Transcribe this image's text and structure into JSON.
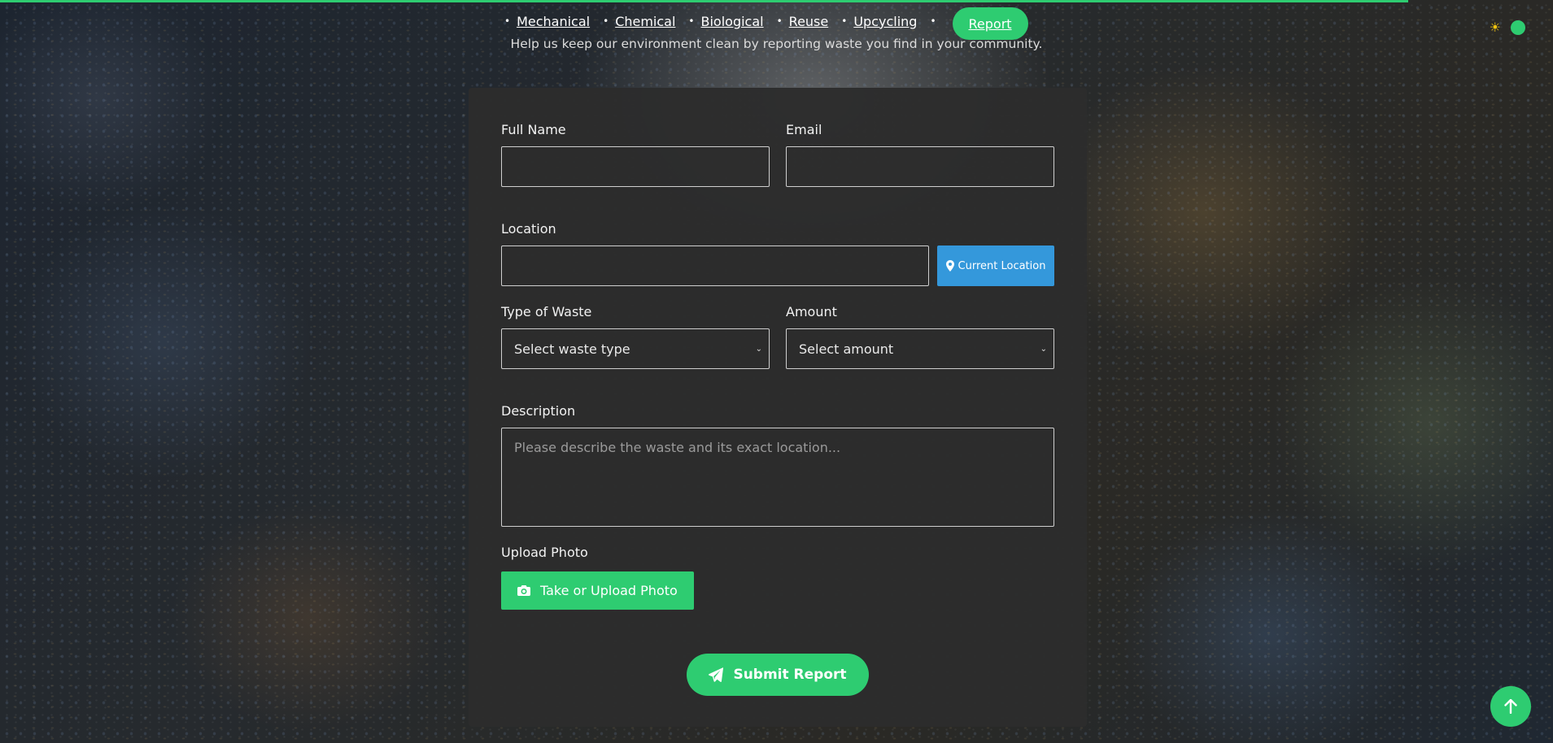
{
  "nav": {
    "items": [
      {
        "label": "Mechanical"
      },
      {
        "label": "Chemical"
      },
      {
        "label": "Biological"
      },
      {
        "label": "Reuse"
      },
      {
        "label": "Upcycling"
      }
    ],
    "report_label": "Report"
  },
  "header": {
    "subtitle": "Help us keep our environment clean by reporting waste you find in your community."
  },
  "form": {
    "full_name_label": "Full Name",
    "full_name_value": "",
    "email_label": "Email",
    "email_value": "",
    "location_label": "Location",
    "location_value": "",
    "current_location_label": "Current Location",
    "waste_type_label": "Type of Waste",
    "waste_type_selected": "Select waste type",
    "amount_label": "Amount",
    "amount_selected": "Select amount",
    "description_label": "Description",
    "description_placeholder": "Please describe the waste and its exact location...",
    "upload_label": "Upload Photo",
    "upload_button_label": "Take or Upload Photo",
    "submit_label": "Submit Report"
  },
  "icons": {
    "theme": "sun-icon",
    "location": "map-pin-icon",
    "camera": "camera-icon",
    "send": "paper-plane-icon",
    "scroll_top": "arrow-up-icon"
  },
  "colors": {
    "accent": "#2ecc71",
    "location_button": "#3498db",
    "card_background": "#2c2c2c",
    "sun": "#f1c40f"
  }
}
